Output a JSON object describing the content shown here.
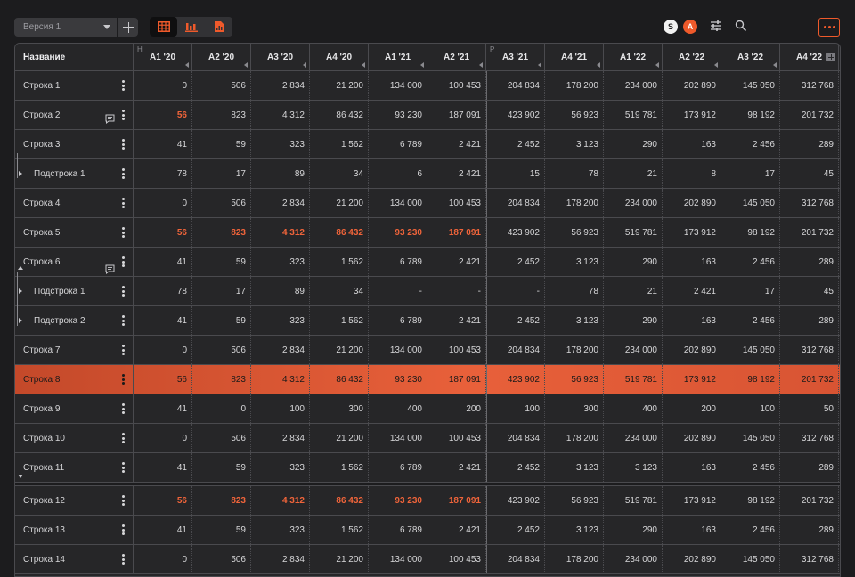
{
  "toolbar": {
    "version_label": "Версия 1",
    "views": [
      "table-icon",
      "bar-chart-icon",
      "document-chart-icon"
    ],
    "active_view": 0,
    "avatars": [
      "S",
      "A"
    ],
    "accent": "#ef5a2b"
  },
  "table": {
    "name_header": "Название",
    "columns": [
      "A1 '20",
      "A2 '20",
      "A3 '20",
      "A4 '20",
      "A1 '21",
      "A2 '21",
      "A3 '21",
      "A4 '21",
      "A1 '22",
      "A2 '22",
      "A3 '22",
      "A4 '22"
    ],
    "group_marks": [
      "H",
      "P"
    ],
    "selected_row": 10,
    "rows": [
      {
        "name": "Строка 1",
        "child": false,
        "values": [
          "0",
          "506",
          "2 834",
          "21 200",
          "134 000",
          "100 453",
          "204 834",
          "178 200",
          "234 000",
          "202 890",
          "145 050",
          "312 768"
        ]
      },
      {
        "name": "Строка 2",
        "child": false,
        "comment": true,
        "hl": [
          0
        ],
        "values": [
          "56",
          "823",
          "4 312",
          "86 432",
          "93 230",
          "187 091",
          "423 902",
          "56 923",
          "519 781",
          "173 912",
          "98 192",
          "201 732"
        ]
      },
      {
        "name": "Строка 3",
        "child": false,
        "values": [
          "41",
          "59",
          "323",
          "1 562",
          "6 789",
          "2 421",
          "2 452",
          "3 123",
          "290",
          "163",
          "2 456",
          "289"
        ]
      },
      {
        "name": "Подстрока 1",
        "child": true,
        "values": [
          "78",
          "17",
          "89",
          "34",
          "6",
          "2 421",
          "15",
          "78",
          "21",
          "8",
          "17",
          "45"
        ]
      },
      {
        "name": "Строка 4",
        "child": false,
        "values": [
          "0",
          "506",
          "2 834",
          "21 200",
          "134 000",
          "100 453",
          "204 834",
          "178 200",
          "234 000",
          "202 890",
          "145 050",
          "312 768"
        ]
      },
      {
        "name": "Строка 5",
        "child": false,
        "hl": [
          0,
          1,
          2,
          3,
          4,
          5
        ],
        "values": [
          "56",
          "823",
          "4 312",
          "86 432",
          "93 230",
          "187 091",
          "423 902",
          "56 923",
          "519 781",
          "173 912",
          "98 192",
          "201 732"
        ]
      },
      {
        "name": "Строка 6",
        "child": false,
        "comment": true,
        "values": [
          "41",
          "59",
          "323",
          "1 562",
          "6 789",
          "2 421",
          "2 452",
          "3 123",
          "290",
          "163",
          "2 456",
          "289"
        ]
      },
      {
        "name": "Подстрока 1",
        "child": true,
        "values": [
          "78",
          "17",
          "89",
          "34",
          "-",
          "-",
          "-",
          "78",
          "21",
          "2 421",
          "17",
          "45"
        ]
      },
      {
        "name": "Подстрока 2",
        "child": true,
        "values": [
          "41",
          "59",
          "323",
          "1 562",
          "6 789",
          "2 421",
          "2 452",
          "3 123",
          "290",
          "163",
          "2 456",
          "289"
        ]
      },
      {
        "name": "Строка 7",
        "child": false,
        "values": [
          "0",
          "506",
          "2 834",
          "21 200",
          "134 000",
          "100 453",
          "204 834",
          "178 200",
          "234 000",
          "202 890",
          "145 050",
          "312 768"
        ]
      },
      {
        "name": "Строка 8",
        "child": false,
        "hl": [
          0
        ],
        "values": [
          "56",
          "823",
          "4 312",
          "86 432",
          "93 230",
          "187 091",
          "423 902",
          "56 923",
          "519 781",
          "173 912",
          "98 192",
          "201 732"
        ]
      },
      {
        "name": "Строка 9",
        "child": false,
        "values": [
          "41",
          "0",
          "100",
          "300",
          "400",
          "200",
          "100",
          "300",
          "400",
          "200",
          "100",
          "50"
        ]
      },
      {
        "name": "Строка 10",
        "child": false,
        "values": [
          "0",
          "506",
          "2 834",
          "21 200",
          "134 000",
          "100 453",
          "204 834",
          "178 200",
          "234 000",
          "202 890",
          "145 050",
          "312 768"
        ]
      },
      {
        "name": "Строка 11",
        "child": false,
        "values": [
          "41",
          "59",
          "323",
          "1 562",
          "6 789",
          "2 421",
          "2 452",
          "3 123",
          "3 123",
          "163",
          "2 456",
          "289"
        ]
      },
      {
        "name": "Строка 12",
        "child": false,
        "hl": [
          0,
          1,
          2,
          3,
          4,
          5
        ],
        "values": [
          "56",
          "823",
          "4 312",
          "86 432",
          "93 230",
          "187 091",
          "423 902",
          "56 923",
          "519 781",
          "173 912",
          "98 192",
          "201 732"
        ]
      },
      {
        "name": "Строка 13",
        "child": false,
        "values": [
          "41",
          "59",
          "323",
          "1 562",
          "6 789",
          "2 421",
          "2 452",
          "3 123",
          "290",
          "163",
          "2 456",
          "289"
        ]
      },
      {
        "name": "Строка 14",
        "child": false,
        "values": [
          "0",
          "506",
          "2 834",
          "21 200",
          "134 000",
          "100 453",
          "204 834",
          "178 200",
          "234 000",
          "202 890",
          "145 050",
          "312 768"
        ]
      }
    ]
  }
}
